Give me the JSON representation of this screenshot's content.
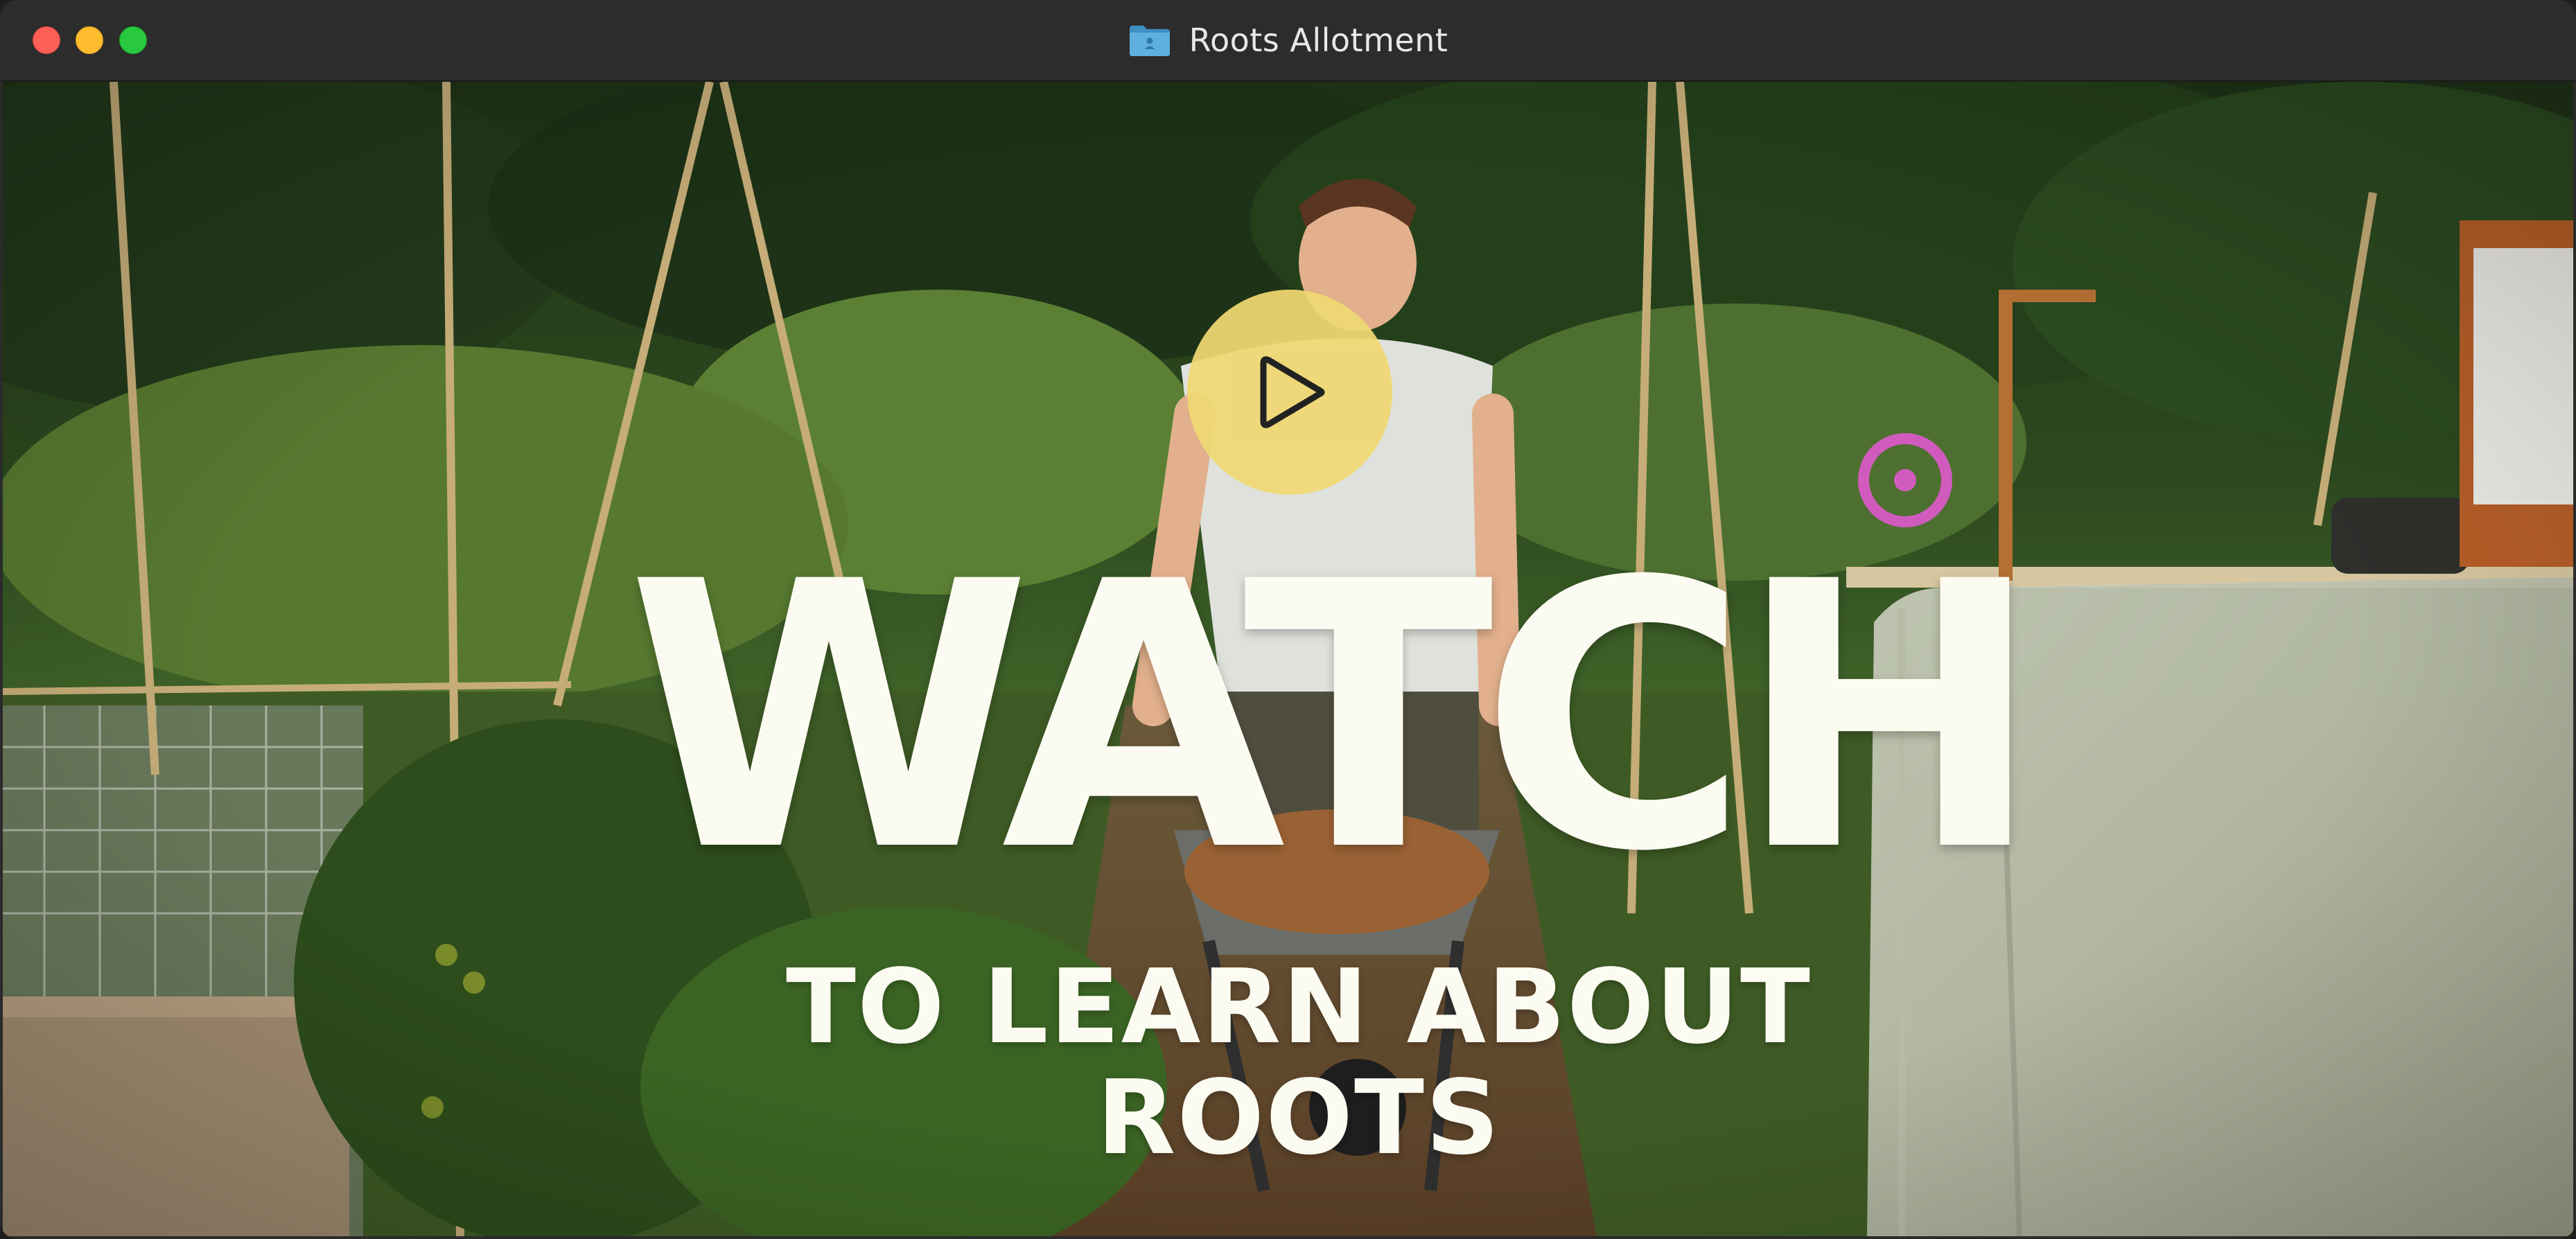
{
  "window": {
    "title": "Roots Allotment",
    "title_icon": "folder-icon"
  },
  "video": {
    "headline": "WATCH",
    "subline": "TO LEARN ABOUT ROOTS",
    "play_icon": "play-icon",
    "play_button_color": "#f0d872",
    "text_color": "#fcfbf1"
  }
}
